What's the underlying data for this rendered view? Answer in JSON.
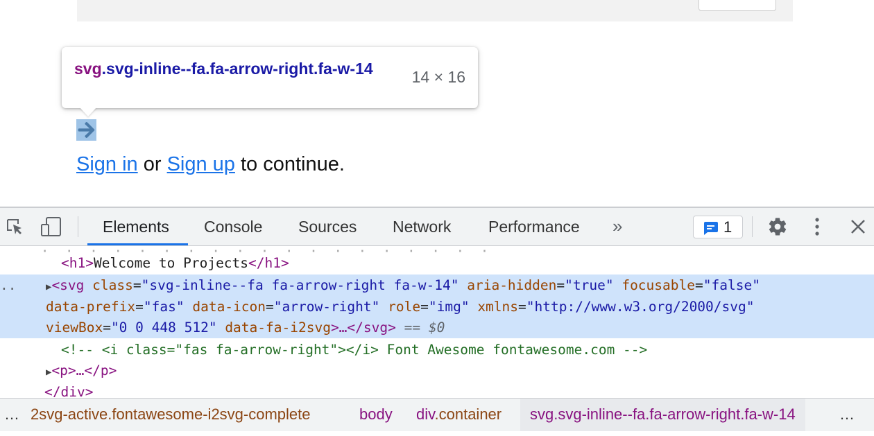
{
  "page": {
    "tooltip": {
      "tag": "svg",
      "classes": ".svg-inline--fa.fa-arrow-right.fa-w-14",
      "dimensions": "14 × 16"
    },
    "signin": {
      "sign_in_link": "Sign in",
      "or_text": " or ",
      "sign_up_link": "Sign up",
      "suffix_text": " to continue."
    }
  },
  "devtools": {
    "tabs": [
      {
        "label": "Elements",
        "active": true
      },
      {
        "label": "Console"
      },
      {
        "label": "Sources"
      },
      {
        "label": "Network"
      },
      {
        "label": "Performance"
      }
    ],
    "more_tabs": "»",
    "issues_count": "1",
    "dom": {
      "line_h1": {
        "open": "<h1>",
        "text": "Welcome to Projects",
        "close": "</h1>"
      },
      "selected": {
        "line1": {
          "tag_open": "<svg",
          "class_name": "class",
          "class_value": "\"svg-inline--fa fa-arrow-right fa-w-14\"",
          "aria_name": "aria-hidden",
          "aria_value": "\"true\"",
          "focusable_name": "focusable",
          "focusable_value": "\"false\""
        },
        "line2": {
          "prefix_name": "data-prefix",
          "prefix_value": "\"fas\"",
          "icon_name": "data-icon",
          "icon_value": "\"arrow-right\"",
          "role_name": "role",
          "role_value": "\"img\"",
          "xmlns_name": "xmlns",
          "xmlns_value": "\"http://www.w3.org/2000/svg\""
        },
        "line3": {
          "viewbox_name": "viewBox",
          "viewbox_value": "\"0 0 448 512\"",
          "i2svg_name": "data-fa-i2svg",
          "tag_close": ">…</svg>",
          "eq": "== $0"
        }
      },
      "comment": "<!-- <i class=\"fas fa-arrow-right\"></i> Font Awesome fontawesome.com -->",
      "p_line": "<p>…</p>",
      "div_close": "</div>"
    },
    "breadcrumbs": {
      "left_ellipsis": "…",
      "right_ellipsis": "…",
      "items": [
        {
          "tag": "",
          "rest": "2svg-active.fontawesome-i2svg-complete"
        },
        {
          "tag": "body",
          "rest": ""
        },
        {
          "tag": "div",
          "rest": ".container"
        },
        {
          "tag": "svg",
          "rest": ".svg-inline--fa.fa-arrow-right.fa-w-14"
        }
      ]
    }
  },
  "icons": {
    "inspect": "inspect-element-icon",
    "device": "device-toolbar-icon",
    "issues": "issues-chat-icon",
    "settings": "gear-icon",
    "menu": "kebab-menu-icon",
    "close": "close-icon",
    "arrow": "arrow-right-icon"
  },
  "colors": {
    "accent": "#1a73e8",
    "tag": "#881280",
    "attr_name": "#994500",
    "attr_value": "#1a1aa6",
    "comment": "#236e25",
    "selection": "#cfe3fb"
  }
}
